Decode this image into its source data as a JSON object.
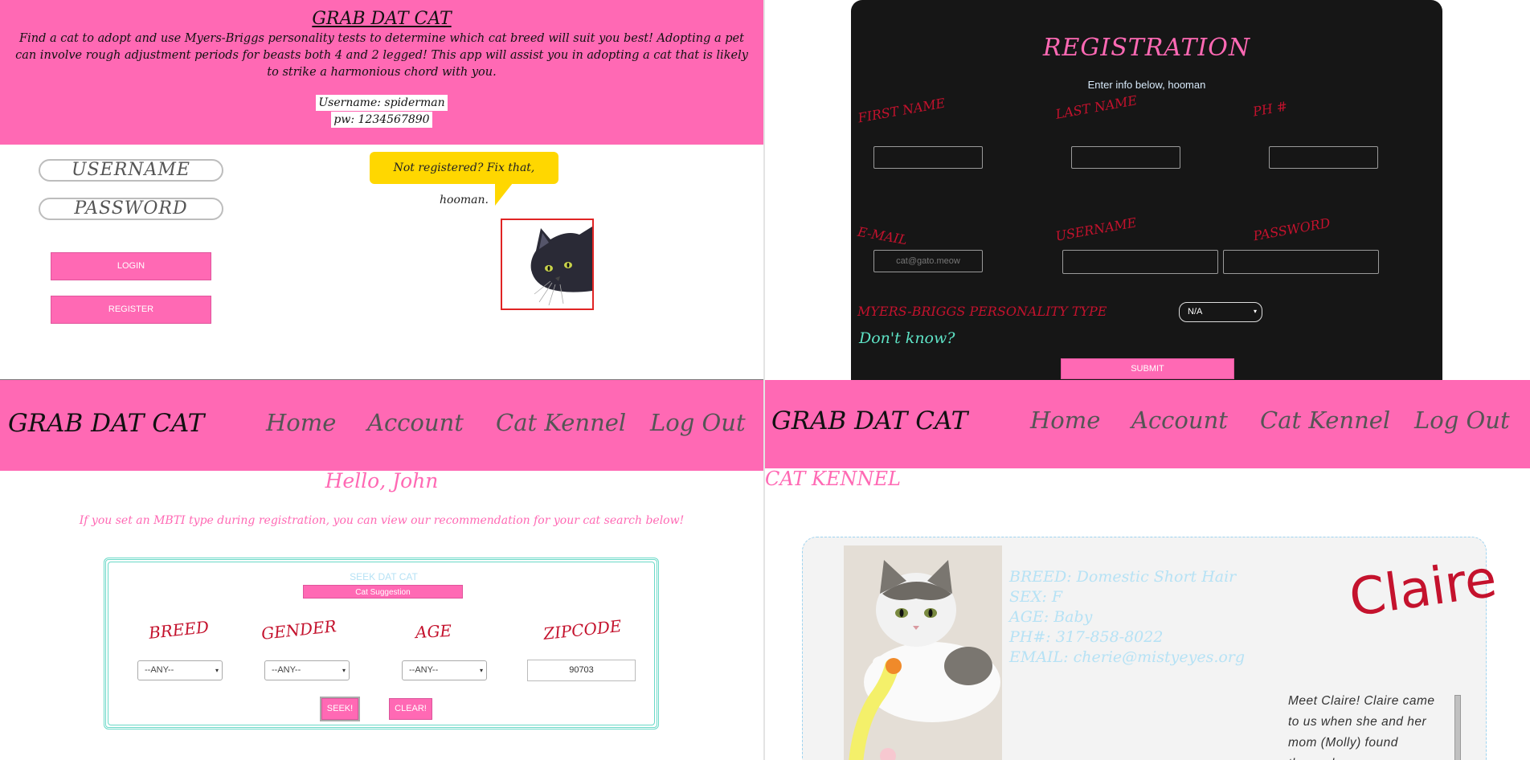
{
  "login": {
    "title": "GRAB DAT CAT",
    "description": "Find a cat to adopt and use Myers-Briggs personality tests to determine which cat breed will suit you best! Adopting a pet can involve rough adjustment periods for beasts both 4 and 2 legged! This app will assist you in adopting a cat that is likely to strike a harmonious chord with you.",
    "demo_username": "Username: spiderman",
    "demo_password": "pw: 1234567890",
    "username_placeholder": "USERNAME",
    "password_placeholder": "PASSWORD",
    "login_label": "LOGIN",
    "register_label": "REGISTER",
    "bubble_text": "Not registered? Fix that, hooman."
  },
  "registration": {
    "title": "REGISTRATION",
    "subtitle": "Enter info below, hooman",
    "first_name_label": "FIRST NAME",
    "last_name_label": "LAST NAME",
    "phone_label": "PH #",
    "email_label": "E-MAIL",
    "email_placeholder": "cat@gato.meow",
    "username_label": "USERNAME",
    "password_label": "PASSWORD",
    "mbti_label": "MYERS-BRIGGS PERSONALITY TYPE",
    "mbti_value": "N/A",
    "dont_know": "Don't know?",
    "submit_label": "SUBMIT"
  },
  "nav": {
    "brand": "GRAB DAT CAT",
    "links": [
      "Home",
      "Account",
      "Cat Kennel",
      "Log Out"
    ]
  },
  "account": {
    "greeting": "Hello, John",
    "note": "If you set an MBTI type during registration, you can view our recommendation for your cat search below!",
    "seek_title": "SEEK DAT CAT",
    "suggest_label": "Cat Suggestion",
    "breed_label": "BREED",
    "gender_label": "GENDER",
    "age_label": "AGE",
    "zip_label": "ZIPCODE",
    "breed_value": "--ANY--",
    "gender_value": "--ANY--",
    "age_value": "--ANY--",
    "zip_value": "90703",
    "seek_button": "SEEK!",
    "clear_button": "CLEAR!"
  },
  "kennel": {
    "title": "CAT KENNEL",
    "cat": {
      "breed": "BREED: Domestic Short Hair",
      "sex": "SEX: F",
      "age": "AGE: Baby",
      "phone": "PH#: 317-858-8022",
      "email": "EMAIL: cherie@mistyeyes.org",
      "name": "Claire",
      "bio": "Meet Claire! Claire came to us when she and her mom (Molly) found themselves"
    }
  },
  "colors": {
    "pink": "#ff69b4",
    "red": "#c4122d",
    "teal": "#6ad9c8",
    "yellow": "#ffd700",
    "dark": "#161616"
  }
}
